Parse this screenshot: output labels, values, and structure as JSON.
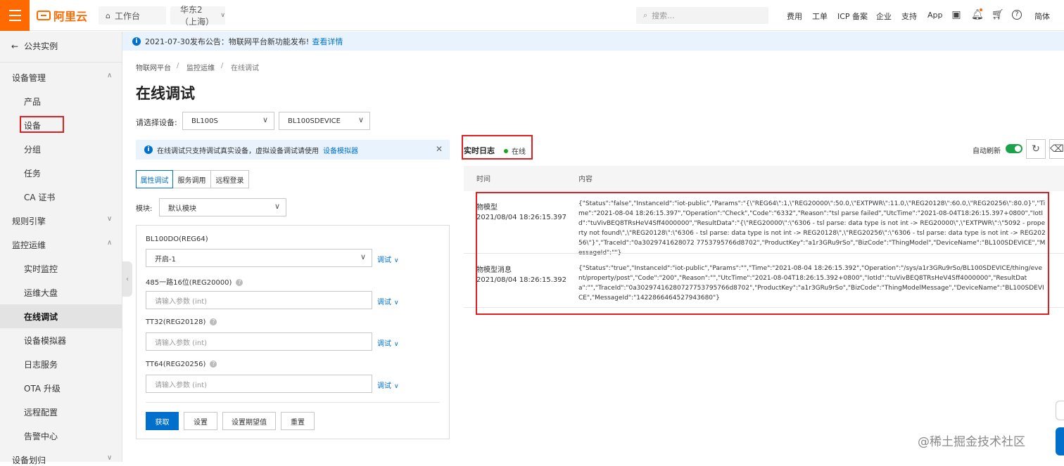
{
  "topbar": {
    "logo": "阿里云",
    "workbench": "工作台",
    "region": "华东2（上海）",
    "search_placeholder": "搜索...",
    "nav": [
      "费用",
      "工单",
      "ICP 备案",
      "企业",
      "支持",
      "App"
    ],
    "language": "简体"
  },
  "notice": {
    "text": "2021-07-30发布公告：物联网平台新功能发布!",
    "link": "查看详情"
  },
  "sidebar": {
    "back": "公共实例",
    "groups": [
      {
        "label": "设备管理",
        "items": [
          "产品",
          "设备",
          "分组",
          "任务",
          "CA 证书"
        ]
      },
      {
        "label": "规则引擎",
        "items": []
      },
      {
        "label": "监控运维",
        "items": [
          "实时监控",
          "运维大盘",
          "在线调试",
          "设备模拟器",
          "日志服务",
          "OTA 升级",
          "远程配置",
          "告警中心"
        ]
      },
      {
        "label": "设备划归",
        "items": []
      }
    ]
  },
  "breadcrumb": [
    "物联网平台",
    "监控运维",
    "在线调试"
  ],
  "page": {
    "title": "在线调试"
  },
  "device_select": {
    "label": "请选择设备:",
    "product": "BL100S",
    "device": "BL100SDEVICE"
  },
  "tip": {
    "text": "在线调试只支持调试真实设备，虚拟设备调试请使用",
    "link": "设备模拟器"
  },
  "tabs": [
    "属性调试",
    "服务调用",
    "远程登录"
  ],
  "module": {
    "label": "模块:",
    "value": "默认模块"
  },
  "properties": [
    {
      "label": "BL100DO(REG64)",
      "value": "开启-1",
      "placeholder": "",
      "help": false
    },
    {
      "label": "485一路16位(REG20000)",
      "value": "",
      "placeholder": "请输入参数 (int)",
      "help": true
    },
    {
      "label": "TT32(REG20128)",
      "value": "",
      "placeholder": "请输入参数 (int)",
      "help": true
    },
    {
      "label": "TT64(REG20256)",
      "value": "",
      "placeholder": "请输入参数 (int)",
      "help": true
    }
  ],
  "debug_label": "调试",
  "buttons": {
    "get": "获取",
    "set": "设置",
    "set_expected": "设置期望值",
    "reset": "重置"
  },
  "log": {
    "title": "实时日志",
    "status": "在线",
    "auto_refresh": "自动刷新",
    "auto_refresh_on": true,
    "columns": [
      "时间",
      "内容"
    ],
    "rows": [
      {
        "type": "物模型",
        "time": "2021/08/04 18:26:15.397",
        "content": "{\"Status\":\"false\",\"InstanceId\":\"iot-public\",\"Params\":\"{\\\"REG64\\\":1,\\\"REG20000\\\":50.0,\\\"EXTPWR\\\":11.0,\\\"REG20128\\\":60.0,\\\"REG20256\\\":80.0}\",\"Time\":\"2021-08-04 18:26:15.397\",\"Operation\":\"Check\",\"Code\":\"6332\",\"Reason\":\"tsl parse failed\",\"UtcTime\":\"2021-08-04T18:26:15.397+0800\",\"IotId\":\"tuVivBEQ8TRsHeV4Sff4000000\",\"ResultData\":\"{\\\"REG20000\\\":\\\"6306 - tsl parse: data type is not int -> REG20000\\\",\\\"EXTPWR\\\":\\\"5092 - property not found\\\",\\\"REG20128\\\":\\\"6306 - tsl parse: data type is not int -> REG20128\\\",\\\"REG20256\\\":\\\"6306 - tsl parse: data type is not int -> REG20256\\\"}\",\"TraceId\":\"0a3029741628072 7753795766d8702\",\"ProductKey\":\"a1r3GRu9rSo\",\"BizCode\":\"ThingModel\",\"DeviceName\":\"BL100SDEVICE\",\"MessageId\":\"\"}"
      },
      {
        "type": "物模型消息",
        "time": "2021/08/04 18:26:15.392",
        "content": "{\"Status\":\"true\",\"InstanceId\":\"iot-public\",\"Params\":\"\",\"Time\":\"2021-08-04 18:26:15.392\",\"Operation\":\"/sys/a1r3GRu9rSo/BL100SDEVICE/thing/event/property/post\",\"Code\":\"200\",\"Reason\":\"\",\"UtcTime\":\"2021-08-04T18:26:15.392+0800\",\"IotId\":\"tuVivBEQ8TRsHeV4Sff4000000\",\"ResultData\":\"\",\"TraceId\":\"0a30297416280727753795766d8702\",\"ProductKey\":\"a1r3GRu9rSo\",\"BizCode\":\"ThingModelMessage\",\"DeviceName\":\"BL100SDEVICE\",\"MessageId\":\"1422866464527943680\"}"
      }
    ]
  },
  "watermark": "@稀土掘金技术社区",
  "colors": {
    "brand": "#ff6a00",
    "primary": "#0070cc",
    "annotation": "#e02020",
    "online": "#20a020"
  }
}
